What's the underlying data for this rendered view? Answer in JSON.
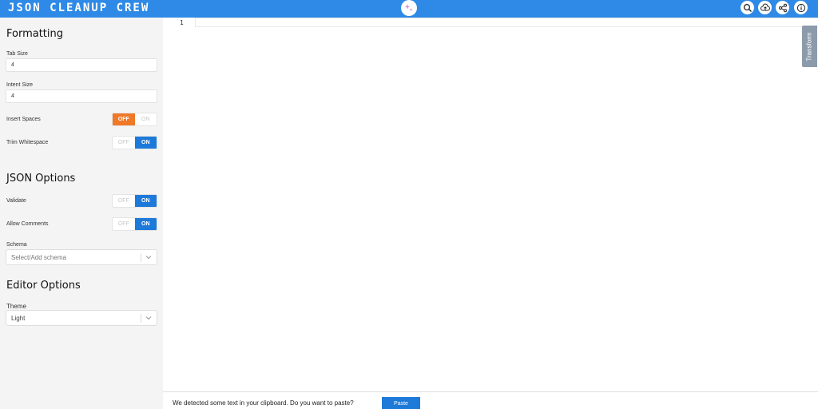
{
  "header": {
    "brand": "JSON CLEANUP CREW",
    "logo_icon": "sparkle-icon",
    "actions": [
      {
        "name": "search-icon"
      },
      {
        "name": "upload-icon"
      },
      {
        "name": "share-icon"
      },
      {
        "name": "info-icon"
      }
    ]
  },
  "sidebar": {
    "formatting": {
      "title": "Formatting",
      "tab_size_label": "Tab Size",
      "tab_size_value": "4",
      "intent_size_label": "Intent Size",
      "intent_size_value": "4",
      "insert_spaces_label": "Insert Spaces",
      "insert_spaces_state": "OFF",
      "trim_whitespace_label": "Trim Whitespace",
      "trim_whitespace_state": "ON"
    },
    "json_options": {
      "title": "JSON Options",
      "validate_label": "Validate",
      "validate_state": "ON",
      "allow_comments_label": "Allow Comments",
      "allow_comments_state": "ON",
      "schema_label": "Schema",
      "schema_placeholder": "Select/Add schema"
    },
    "editor_options": {
      "title": "Editor Options",
      "theme_label": "Theme",
      "theme_value": "Light"
    },
    "toggle_off_label": "OFF",
    "toggle_on_label": "ON"
  },
  "editor": {
    "line_numbers": [
      "1"
    ],
    "transform_tab": "Transform"
  },
  "clipboard_bar": {
    "message": "We detected some text in your clipboard. Do you want to paste?",
    "paste_label": "Paste"
  },
  "colors": {
    "header": "#2e8ae6",
    "toggle_on": "#1e7ad9",
    "toggle_off": "#f07826",
    "sidebar_bg": "#f4f4f4"
  }
}
